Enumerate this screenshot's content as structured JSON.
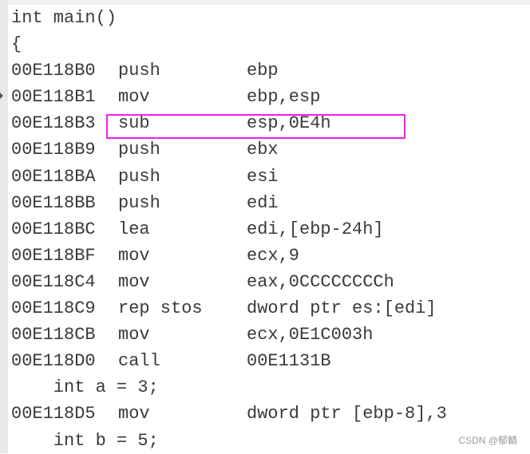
{
  "lines": [
    {
      "type": "source",
      "text": "int main()"
    },
    {
      "type": "source",
      "text": "{"
    },
    {
      "type": "asm",
      "addr": "00E118B0",
      "mnemonic": "push",
      "operand": "ebp"
    },
    {
      "type": "asm",
      "addr": "00E118B1",
      "mnemonic": "mov",
      "operand": "ebp,esp"
    },
    {
      "type": "asm",
      "addr": "00E118B3",
      "mnemonic": "sub",
      "operand": "esp,0E4h",
      "highlighted": true
    },
    {
      "type": "asm",
      "addr": "00E118B9",
      "mnemonic": "push",
      "operand": "ebx"
    },
    {
      "type": "asm",
      "addr": "00E118BA",
      "mnemonic": "push",
      "operand": "esi"
    },
    {
      "type": "asm",
      "addr": "00E118BB",
      "mnemonic": "push",
      "operand": "edi"
    },
    {
      "type": "asm",
      "addr": "00E118BC",
      "mnemonic": "lea",
      "operand": "edi,[ebp-24h]"
    },
    {
      "type": "asm",
      "addr": "00E118BF",
      "mnemonic": "mov",
      "operand": "ecx,9"
    },
    {
      "type": "asm",
      "addr": "00E118C4",
      "mnemonic": "mov",
      "operand": "eax,0CCCCCCCCh"
    },
    {
      "type": "asm",
      "addr": "00E118C9",
      "mnemonic": "rep stos",
      "operand": "dword ptr es:[edi]"
    },
    {
      "type": "asm",
      "addr": "00E118CB",
      "mnemonic": "mov",
      "operand": "ecx,0E1C003h"
    },
    {
      "type": "asm",
      "addr": "00E118D0",
      "mnemonic": "call",
      "operand": "00E1131B"
    },
    {
      "type": "source",
      "text": "    int a = 3;"
    },
    {
      "type": "asm",
      "addr": "00E118D5",
      "mnemonic": "mov",
      "operand": "dword ptr [ebp-8],3"
    },
    {
      "type": "source",
      "text": "    int b = 5;"
    }
  ],
  "highlight_color": "#f01ef0",
  "watermark": "CSDN @郁鲭"
}
